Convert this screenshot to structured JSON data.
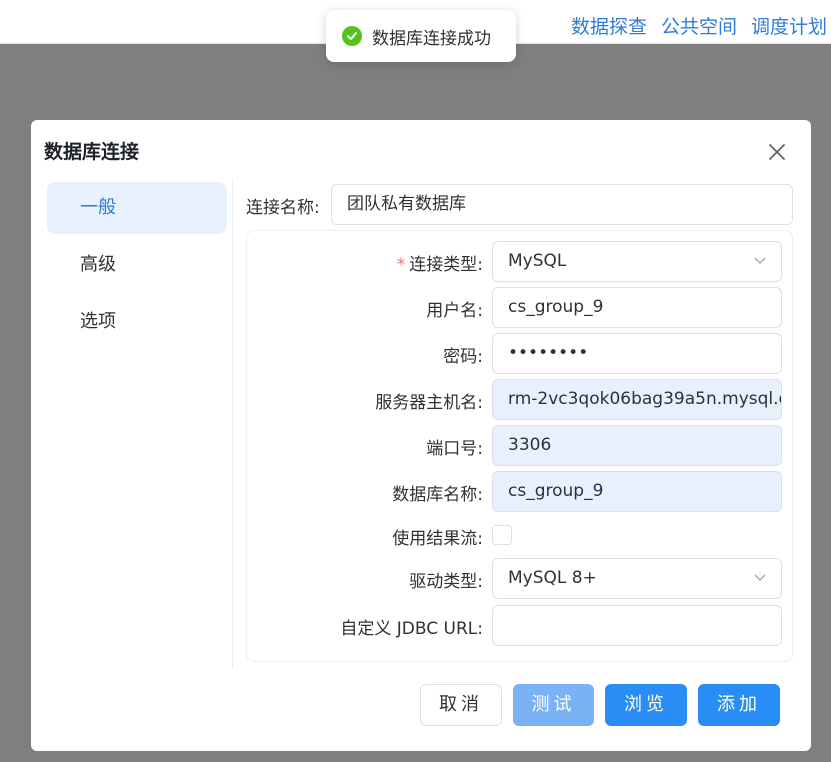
{
  "topnav": {
    "items": [
      "数据探查",
      "公共空间",
      "调度计划"
    ]
  },
  "toast": {
    "message": "数据库连接成功",
    "icon": "check-circle-icon",
    "color": "#52c41a"
  },
  "dialog": {
    "title": "数据库连接",
    "sidebar": [
      "一般",
      "高级",
      "选项"
    ],
    "connection_name": {
      "label": "连接名称:",
      "value": "团队私有数据库"
    },
    "fields": {
      "conn_type": {
        "label": "连接类型:",
        "value": "MySQL",
        "required": "*"
      },
      "username": {
        "label": "用户名:",
        "value": "cs_group_9"
      },
      "password": {
        "label": "密码:",
        "value": "••••••••"
      },
      "host": {
        "label": "服务器主机名:",
        "value": "rm-2vc3qok06bag39a5n.mysql.c"
      },
      "port": {
        "label": "端口号:",
        "value": "3306"
      },
      "database": {
        "label": "数据库名称:",
        "value": "cs_group_9"
      },
      "use_stream": {
        "label": "使用结果流:",
        "checked": false
      },
      "driver_type": {
        "label": "驱动类型:",
        "value": "MySQL 8+"
      },
      "jdbc_url": {
        "label": "自定义 JDBC URL:",
        "value": ""
      }
    },
    "buttons": {
      "cancel": "取消",
      "test": "测试",
      "browse": "浏览",
      "add": "添加"
    }
  },
  "colors": {
    "accent": "#2a8df5",
    "link": "#2f7bd8",
    "required": "#f56c6c"
  }
}
